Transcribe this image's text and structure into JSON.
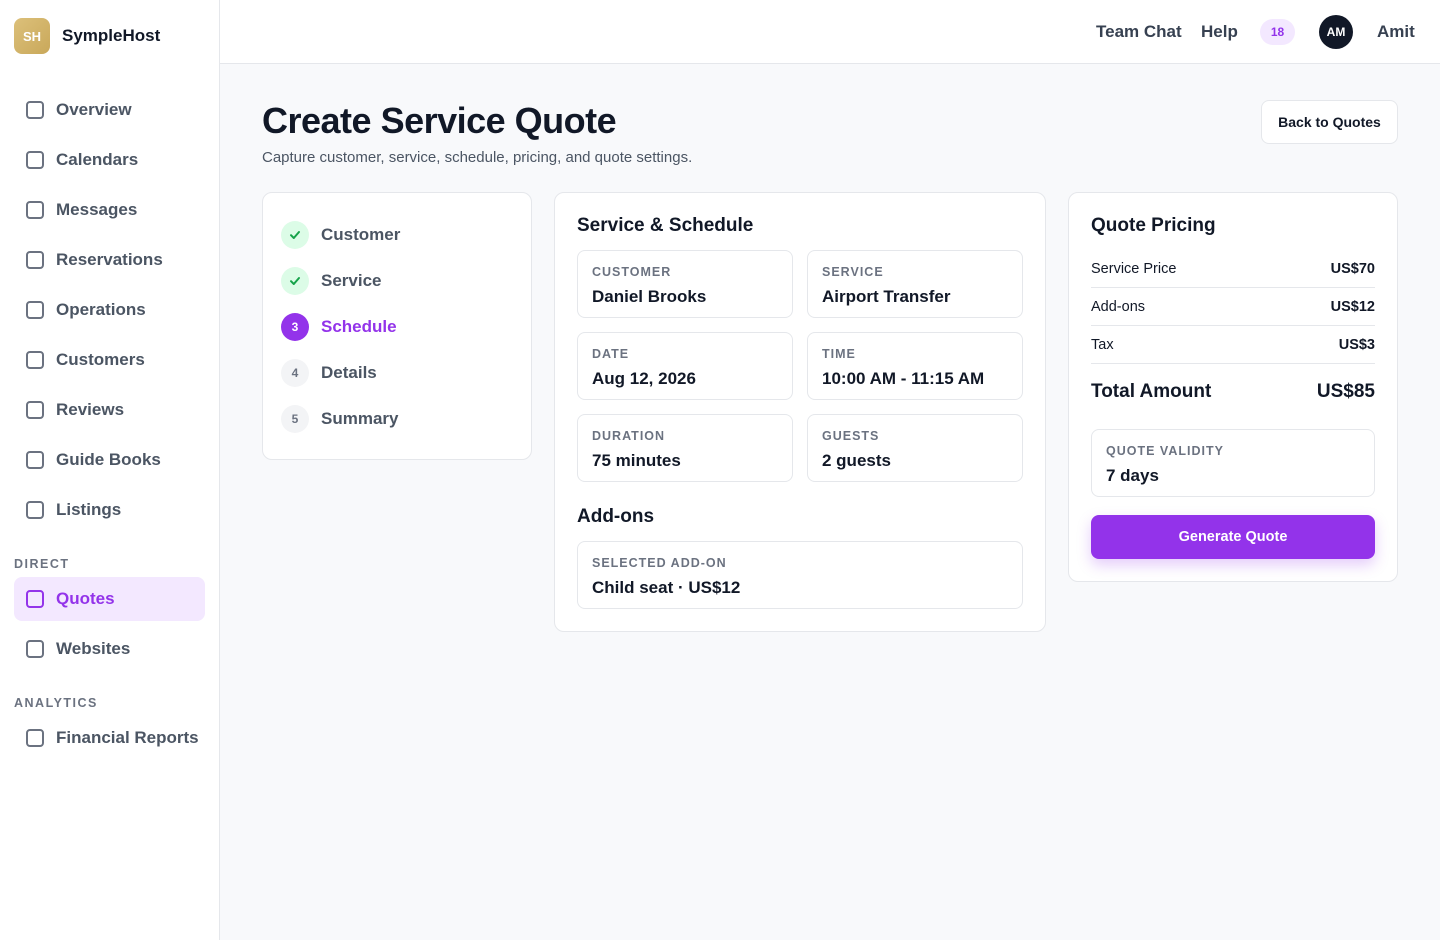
{
  "brand": {
    "logo_text": "SH",
    "name": "SympleHost"
  },
  "sidebar": {
    "items": [
      {
        "label": "Overview"
      },
      {
        "label": "Calendars"
      },
      {
        "label": "Messages"
      },
      {
        "label": "Reservations"
      },
      {
        "label": "Operations"
      },
      {
        "label": "Customers"
      },
      {
        "label": "Reviews"
      },
      {
        "label": "Guide Books"
      },
      {
        "label": "Listings"
      }
    ],
    "direct_label": "DIRECT",
    "direct_items": [
      {
        "label": "Quotes",
        "active": true
      },
      {
        "label": "Websites"
      }
    ],
    "analytics_label": "ANALYTICS",
    "analytics_items": [
      {
        "label": "Financial Reports"
      }
    ]
  },
  "topbar": {
    "team_chat": "Team Chat",
    "help": "Help",
    "notifications": "18",
    "avatar_initials": "AM",
    "user_name": "Amit"
  },
  "page": {
    "title": "Create Service Quote",
    "subtitle": "Capture customer, service, schedule, pricing, and quote settings.",
    "back_button": "Back to Quotes"
  },
  "steps": [
    {
      "number": "1",
      "label": "Customer",
      "status": "done"
    },
    {
      "number": "2",
      "label": "Service",
      "status": "done"
    },
    {
      "number": "3",
      "label": "Schedule",
      "status": "current"
    },
    {
      "number": "4",
      "label": "Details",
      "status": "pending"
    },
    {
      "number": "5",
      "label": "Summary",
      "status": "pending"
    }
  ],
  "schedule": {
    "title": "Service & Schedule",
    "customer": {
      "label": "CUSTOMER",
      "value": "Daniel Brooks"
    },
    "service": {
      "label": "SERVICE",
      "value": "Airport Transfer"
    },
    "date": {
      "label": "DATE",
      "value": "Aug 12, 2026"
    },
    "time": {
      "label": "TIME",
      "value": "10:00 AM - 11:15 AM"
    },
    "duration": {
      "label": "DURATION",
      "value": "75 minutes"
    },
    "guests": {
      "label": "GUESTS",
      "value": "2 guests"
    },
    "addons_title": "Add-ons",
    "addon": {
      "label": "SELECTED ADD-ON",
      "value": "Child seat · US$12"
    }
  },
  "pricing": {
    "title": "Quote Pricing",
    "service_price_label": "Service Price",
    "service_price": "US$70",
    "addons_label": "Add-ons",
    "addons": "US$12",
    "tax_label": "Tax",
    "tax": "US$3",
    "total_label": "Total Amount",
    "total": "US$85",
    "validity_label": "QUOTE VALIDITY",
    "validity_value": "7 days",
    "generate_button": "Generate Quote"
  },
  "colors": {
    "accent": "#9333ea",
    "accent_light": "#f3e8ff",
    "success_light": "#dcfce7",
    "success": "#16a34a"
  }
}
